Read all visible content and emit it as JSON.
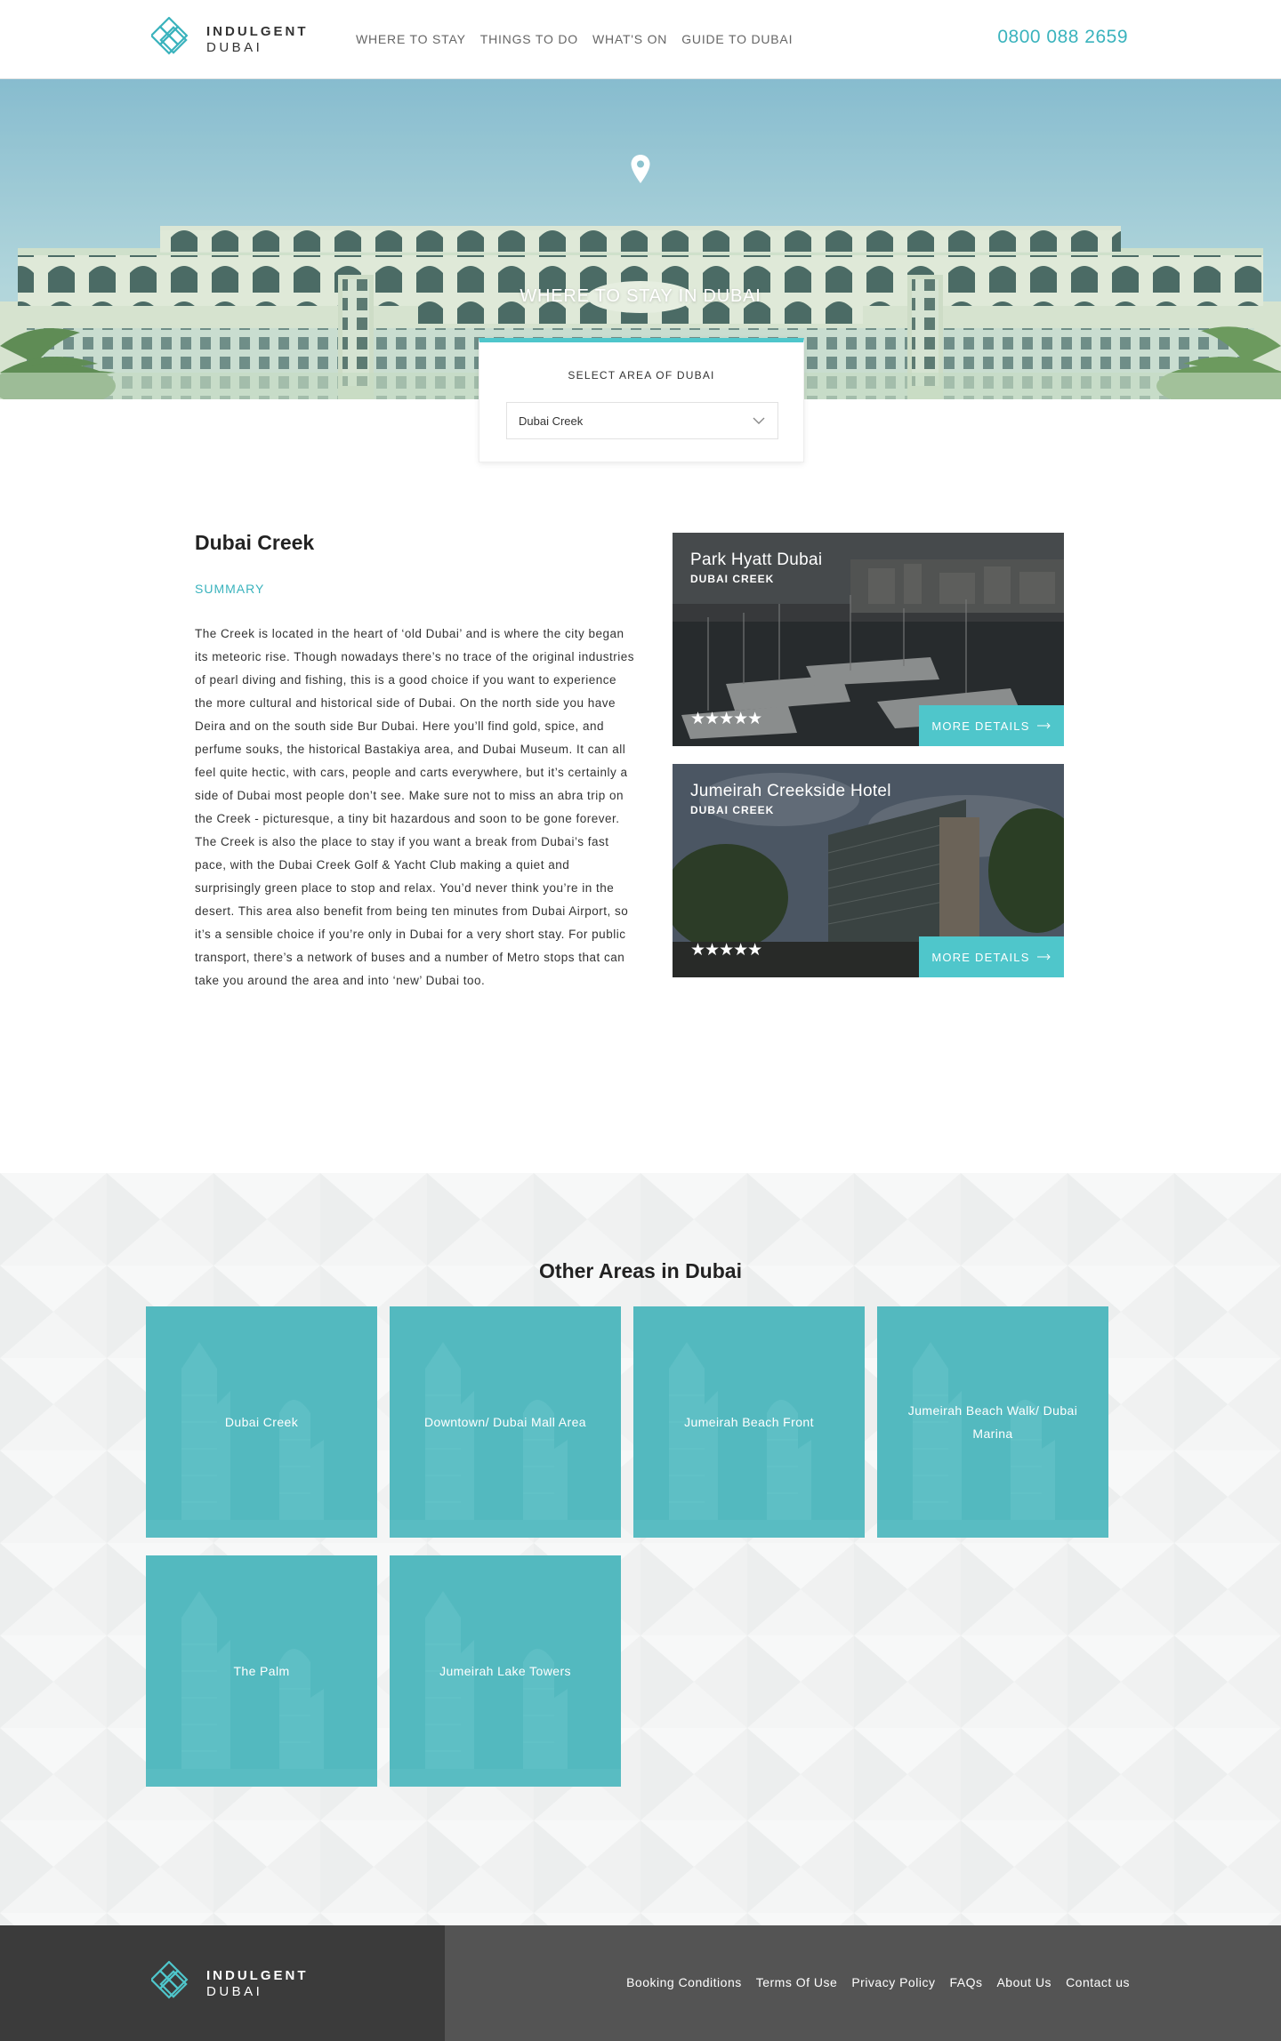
{
  "brand": {
    "line1": "INDULGENT",
    "line2": "DUBAI"
  },
  "nav": {
    "items": [
      "WHERE TO STAY",
      "THINGS TO DO",
      "WHAT'S ON",
      "GUIDE TO DUBAI"
    ]
  },
  "phone": "0800 088 2659",
  "hero": {
    "title": "WHERE TO STAY IN DUBAI",
    "icon": "location-pin-icon"
  },
  "area_select": {
    "label": "SELECT AREA OF DUBAI",
    "selected": "Dubai Creek"
  },
  "area": {
    "title": "Dubai Creek",
    "summary_label": "SUMMARY",
    "summary": "The Creek is located in the heart of ‘old Dubai’ and is where the city began its meteoric rise. Though nowadays there’s no trace of the original industries of pearl diving and fishing, this is a good choice if you want to experience the more cultural and historical side of Dubai. On the north side you have Deira and on the south side Bur Dubai. Here you’ll find gold, spice, and perfume souks, the historical Bastakiya area, and Dubai Museum. It can all feel quite hectic, with cars, people and carts everywhere, but it’s certainly a side of Dubai most people don’t see. Make sure not to miss an abra trip on the Creek - picturesque, a tiny bit hazardous and soon to be gone forever. The Creek is also the place to stay if you want a break from Dubai’s fast pace, with the Dubai Creek Golf & Yacht Club making a quiet and surprisingly green place to stop and relax. You’d never think you’re in the desert. This area also benefit from being ten minutes from Dubai Airport, so it’s a sensible choice if you’re only in Dubai for a very short stay. For public transport, there’s a network of buses and a number of Metro stops that can take you around the area and into ‘new’ Dubai too."
  },
  "hotels": [
    {
      "name": "Park Hyatt Dubai",
      "area": "DUBAI CREEK",
      "rating": 5,
      "stars": "★★★★★",
      "button": "MORE DETAILS"
    },
    {
      "name": "Jumeirah Creekside Hotel",
      "area": "DUBAI CREEK",
      "rating": 5,
      "stars": "★★★★★",
      "button": "MORE DETAILS"
    }
  ],
  "other_areas": {
    "title": "Other Areas in Dubai",
    "items": [
      "Dubai Creek",
      "Downtown/ Dubai Mall Area",
      "Jumeirah Beach Front",
      "Jumeirah Beach Walk/ Dubai Marina",
      "The Palm",
      "Jumeirah Lake Towers"
    ]
  },
  "footer": {
    "links": [
      "Booking Conditions",
      "Terms Of Use",
      "Privacy Policy",
      "FAQs",
      "About Us",
      "Contact us"
    ]
  },
  "colors": {
    "accent": "#4fc6cb",
    "accent_text": "#3ab3bd",
    "footer_dark": "#3b3b3b",
    "footer": "#545454"
  }
}
